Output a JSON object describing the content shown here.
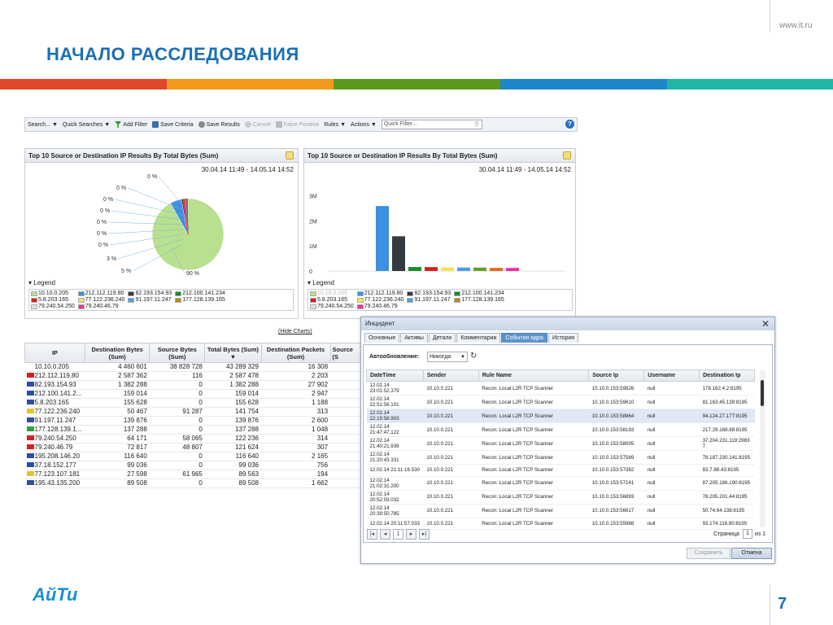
{
  "slide": {
    "title": "НАЧАЛО РАССЛЕДОВАНИЯ",
    "url": "www.it.ru",
    "logo": "АйТи",
    "page_number": "7",
    "stripe_colors": [
      "#e2482a",
      "#f39a1d",
      "#5b9a1e",
      "#1f87c8",
      "#1fb7a3"
    ]
  },
  "toolbar": {
    "search": "Search... ▼",
    "quick_searches": "Quick Searches ▼",
    "add_filter": "Add Filter",
    "save_criteria": "Save Criteria",
    "save_results": "Save Results",
    "cancel": "Cancel",
    "false_positive": "False Positive",
    "rules": "Rules ▼",
    "actions": "Actions ▼",
    "quick_filter_placeholder": "Quick Filter...",
    "help": "?"
  },
  "pie_panel": {
    "title": "Top 10 Source or Destination IP Results By Total Bytes (Sum)",
    "range": "30.04.14 11:49 - 14.05.14 14:52",
    "legend_label": "Legend",
    "pct_labels": [
      "0 %",
      "0 %",
      "0 %",
      "0 %",
      "0 %",
      "0 %",
      "0 %",
      "3 %",
      "5 %",
      "90 %"
    ]
  },
  "bar_panel": {
    "title": "Top 10 Source or Destination IP Results By Total Bytes (Sum)",
    "range": "30.04.14 11:49 - 14.05.14 14:52",
    "legend_label": "Legend",
    "y_ticks": [
      "3M",
      "2M",
      "1M",
      "0"
    ]
  },
  "chart_data": [
    {
      "type": "pie",
      "title": "Top 10 Source or Destination IP Results By Total Bytes (Sum)",
      "categories": [
        "10.10.0.205",
        "212.112.119.80",
        "82.193.154.93",
        "212.100.141.234",
        "5.8.203.165",
        "77.122.236.240",
        "91.197.11.247",
        "177.128.139.165",
        "79.240.54.250",
        "79.240.46.79"
      ],
      "values": [
        90,
        5,
        3,
        0,
        0,
        0,
        0,
        0,
        0,
        0
      ],
      "colors": [
        "#b8e08e",
        "#3d8fe0",
        "#333a40",
        "#1a8c2c",
        "#d81f1f",
        "#6fb8e8",
        "#8a5a9a",
        "#b58a1e",
        "#ee2b2b",
        "#ef2fa0"
      ],
      "legend": "bottom"
    },
    {
      "type": "bar",
      "title": "Top 10 Source or Destination IP Results By Total Bytes (Sum)",
      "categories": [
        "10.10.0.205",
        "212.112.119.80",
        "82.193.154.93",
        "212.100.141.234",
        "5.8.203.165",
        "77.122.236.240",
        "91.197.11.247",
        "177.128.139.165",
        "79.240.54.250",
        "79.240.46.79"
      ],
      "values": [
        4460601,
        2587362,
        1382288,
        159014,
        155628,
        141754,
        139876,
        137288,
        122236,
        121624
      ],
      "colors": [
        "#b8e08e",
        "#3d8fe0",
        "#333a40",
        "#1a8c2c",
        "#d81f1f",
        "#f5e35a",
        "#4fa0e0",
        "#6a9e2a",
        "#e06820",
        "#ef2fa0"
      ],
      "ylim": [
        0,
        3500000
      ],
      "y_ticks": [
        "3M",
        "2M",
        "1M",
        "0"
      ],
      "legend": "bottom"
    }
  ],
  "legend_items": [
    {
      "label": "10.10.0.205",
      "color": "#b8e08e"
    },
    {
      "label": "212.112.119.80",
      "color": "#3d8fe0"
    },
    {
      "label": "82.193.154.93",
      "color": "#333a40"
    },
    {
      "label": "212.100.141.234",
      "color": "#1a8c2c"
    },
    {
      "label": "5.8.203.165",
      "color": "#d81f1f"
    },
    {
      "label": "77.122.236.240",
      "color": "#f5e35a"
    },
    {
      "label": "91.197.11.247",
      "color": "#4fa0e0"
    },
    {
      "label": "177.128.139.165",
      "color": "#b58a1e"
    },
    {
      "label": "79.240.54.250",
      "color": "#e0e0e0"
    },
    {
      "label": "79.240.46.79",
      "color": "#ef2fa0"
    }
  ],
  "table": {
    "hide_charts": "(Hide Charts)",
    "headers": [
      "IP",
      "Destination Bytes (Sum)",
      "Source Bytes (Sum)",
      "Total Bytes (Sum) ▼",
      "Destination Packets (Sum)",
      "Source (S"
    ],
    "rows": [
      [
        "10.10.0.205",
        "4 460 601",
        "38 828 728",
        "43 289 329",
        "16 308"
      ],
      [
        "212.112.119.80",
        "2 587 362",
        "116",
        "2 587 478",
        "2 203"
      ],
      [
        "82.193.154.93",
        "1 382 288",
        "0",
        "1 382 288",
        "27 902"
      ],
      [
        "212.100.141.2...",
        "159 014",
        "0",
        "159 014",
        "2 947"
      ],
      [
        "5.8.203.165",
        "155 628",
        "0",
        "155 628",
        "1 188"
      ],
      [
        "77.122.236.240",
        "50 467",
        "91 287",
        "141 754",
        "313"
      ],
      [
        "91.197.11.247",
        "139 876",
        "0",
        "139 876",
        "2 600"
      ],
      [
        "177.128.139.1...",
        "137 288",
        "0",
        "137 288",
        "1 048"
      ],
      [
        "79.240.54.250",
        "64 171",
        "58 065",
        "122 236",
        "314"
      ],
      [
        "79.240.46.79",
        "72 817",
        "48 807",
        "121 624",
        "307"
      ],
      [
        "195.208.146.20",
        "116 640",
        "0",
        "116 640",
        "2 165"
      ],
      [
        "37.18.152.177",
        "99 036",
        "0",
        "99 036",
        "756"
      ],
      [
        "77.123.107.181",
        "27 598",
        "61 965",
        "89 563",
        "194"
      ],
      [
        "195.43.135.200",
        "89 508",
        "0",
        "89 508",
        "1 662"
      ]
    ]
  },
  "incident": {
    "title": "Инцидент",
    "close": "✕",
    "tabs": [
      "Основные",
      "Активы",
      "Детали",
      "Комментарии",
      "События ядра",
      "История"
    ],
    "autoupdate_label": "Автообновление:",
    "autoupdate_value": "Никогда",
    "columns": [
      "DateTime",
      "Sender",
      "Rule Name",
      "Source Ip",
      "Username",
      "Destination Ip"
    ],
    "rows": [
      [
        "12.02.14 23:01:52.379",
        "10.10.0.221",
        "Recon: Local L2R TCP Scanner",
        "10.10.0.153:59826",
        "null",
        "178.162.4.2:8195"
      ],
      [
        "12.02.14 22:51:56.101",
        "10.10.0.221",
        "Recon: Local L2R TCP Scanner",
        "10.10.0.153:59610",
        "null",
        "81.163.45.139:8195"
      ],
      [
        "12.02.14 22:19:58.903",
        "10.10.0.221",
        "Recon: Local L2R TCP Scanner",
        "10.10.0.153:58864",
        "null",
        "94.124.27.177:8195"
      ],
      [
        "12.02.14 21:47:47.122",
        "10.10.0.221",
        "Recon: Local L2R TCP Scanner",
        "10.10.0.153:58193",
        "null",
        "217.29.188.88:8195"
      ],
      [
        "12.02.14 21:40:21.939",
        "10.10.0.221",
        "Recon: Local L2R TCP Scanner",
        "10.10.0.153:58005",
        "null",
        "37.204.231.119:29837"
      ],
      [
        "12.02.14 21:20:43.331",
        "10.10.0.221",
        "Recon: Local L2R TCP Scanner",
        "10.10.0.153:57569",
        "null",
        "78.187.230.141:8195"
      ],
      [
        "12.02.14 21:11:16.530",
        "10.10.0.221",
        "Recon: Local L2R TCP Scanner",
        "10.10.0.153:57362",
        "null",
        "83.7.88.43:8195"
      ],
      [
        "12.02.14 21:02:31.200",
        "10.10.0.221",
        "Recon: Local L2R TCP Scanner",
        "10.10.0.153:57141",
        "null",
        "87.205.186.190:8195"
      ],
      [
        "12.02.14 20:52:59.032",
        "10.10.0.221",
        "Recon: Local L2R TCP Scanner",
        "10.10.0.153:56893",
        "null",
        "78.205.201.44:8195"
      ],
      [
        "12.02.14 20:39:50.785",
        "10.10.0.221",
        "Recon: Local L2R TCP Scanner",
        "10.10.0.153:56617",
        "null",
        "50.74.64.138:8195"
      ],
      [
        "12.02.14 20:11:57.033",
        "10.10.0.221",
        "Recon: Local L2R TCP Scanner",
        "10.10.0.153:55988",
        "null",
        "93.174.116.80:8195"
      ]
    ],
    "pager": {
      "first": "|◂",
      "prev": "◂",
      "page": "1",
      "next": "▸",
      "last": "▸|",
      "page_label": "Страница",
      "page_value": "1",
      "of": "из 1"
    },
    "save": "Сохранить",
    "cancel": "Отмена"
  }
}
